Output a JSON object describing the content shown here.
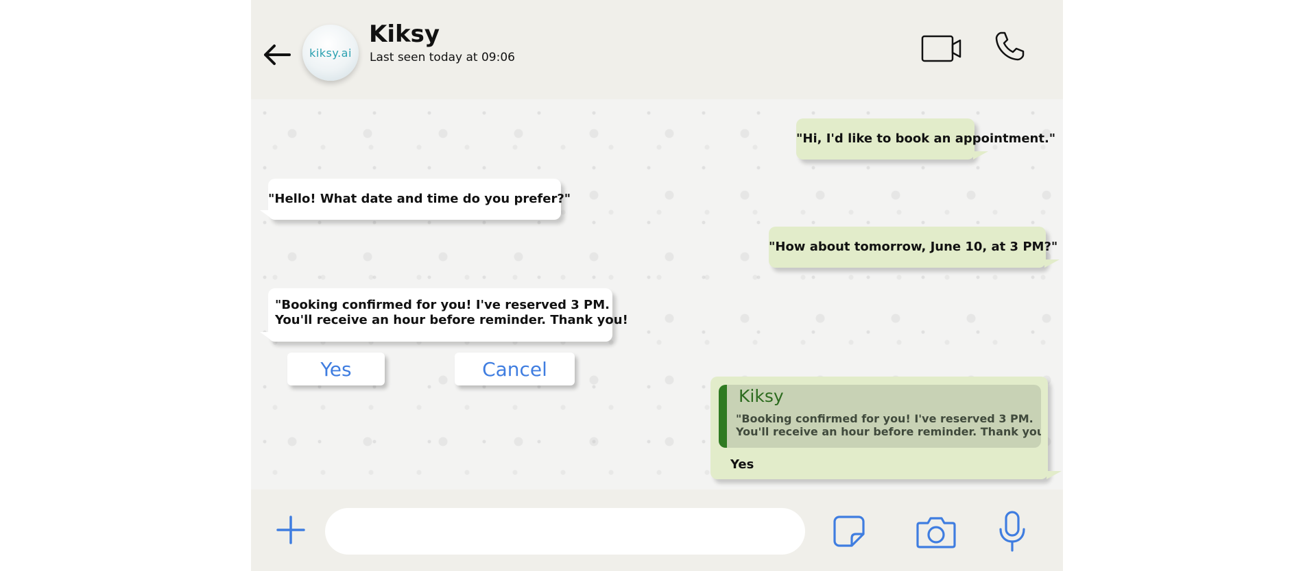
{
  "header": {
    "contact_name": "Kiksy",
    "last_seen": "Last seen today at 09:06",
    "avatar_text": "kiksy.ai",
    "icons": {
      "back": "arrow-left-icon",
      "video": "video-camera-icon",
      "call": "phone-icon"
    }
  },
  "messages": [
    {
      "direction": "out",
      "text": "\"Hi, I'd like to book an appointment.\""
    },
    {
      "direction": "in",
      "text": "\"Hello! What date and time do you prefer?\""
    },
    {
      "direction": "out",
      "text": "\"How about tomorrow, June 10, at 3 PM?\""
    },
    {
      "direction": "in",
      "lines": [
        "\"Booking confirmed for you! I've reserved 3 PM.",
        "You'll receive an hour before reminder. Thank you!"
      ]
    }
  ],
  "quick_replies": {
    "yes": "Yes",
    "cancel": "Cancel"
  },
  "reply": {
    "quoted_name": "Kiksy",
    "quoted_lines": [
      "\"Booking confirmed for you! I've reserved 3 PM.",
      "You'll receive an hour before reminder. Thank you!"
    ],
    "text": "Yes"
  },
  "composer": {
    "input_value": "",
    "icons": {
      "add": "plus-icon",
      "sticker": "sticker-icon",
      "camera": "camera-icon",
      "mic": "microphone-icon"
    }
  },
  "colors": {
    "header_bg": "#f0efea",
    "outgoing_bubble": "#e2ecca",
    "incoming_bubble": "#ffffff",
    "quote_bar": "#2f7a22",
    "accent_blue": "#3f7de0"
  }
}
